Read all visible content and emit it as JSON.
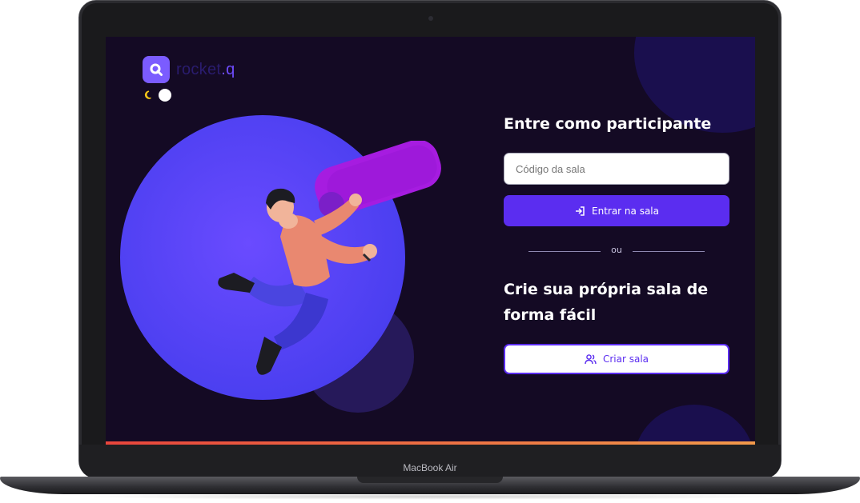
{
  "app": {
    "logo_text": "rocket",
    "logo_suffix": ".q",
    "logo_icon": "magnifier-icon"
  },
  "theme_toggle": {
    "icon": "moon-icon",
    "state": "light"
  },
  "join": {
    "title": "Entre como participante",
    "input_placeholder": "Código da sala",
    "button_label": "Entrar na sala",
    "button_icon": "sign-in-icon"
  },
  "divider": {
    "text": "ou"
  },
  "create": {
    "title": "Crie sua própria sala de forma fácil",
    "button_label": "Criar sala",
    "button_icon": "users-icon"
  },
  "device": {
    "label": "MacBook Air"
  },
  "colors": {
    "background": "#140a24",
    "primary": "#5b2df0",
    "hero_circle": "#4b3ff0",
    "accent_strip_start": "#e8453c",
    "accent_strip_end": "#f2994a"
  }
}
